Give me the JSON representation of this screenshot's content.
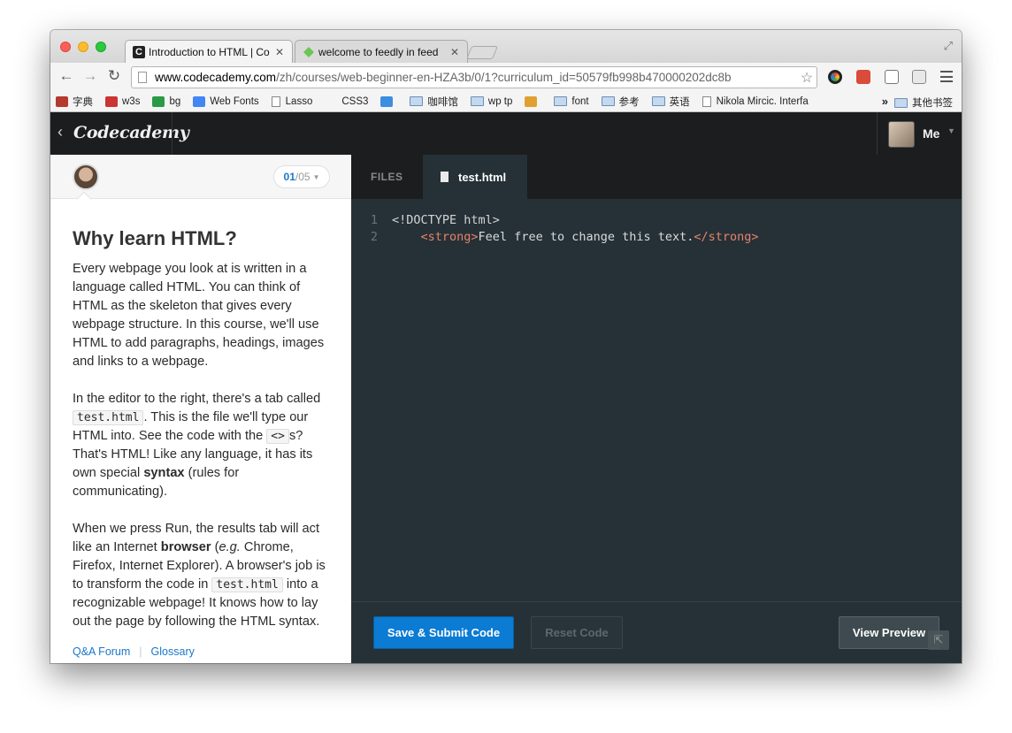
{
  "browser": {
    "tabs": [
      {
        "title": "Introduction to HTML | Co",
        "favicon": "C"
      },
      {
        "title": "welcome to feedly in feed",
        "favicon": ""
      }
    ],
    "url_domain": "www.codecademy.com",
    "url_path": "/zh/courses/web-beginner-en-HZA3b/0/1?curriculum_id=50579fb998b470000202dc8b",
    "bookmarks": [
      {
        "label": "字典",
        "kind": "site",
        "color": "#b33a2d"
      },
      {
        "label": "w3s",
        "kind": "site",
        "color": "#cc3333"
      },
      {
        "label": "bg",
        "kind": "site",
        "color": "#2a9a47"
      },
      {
        "label": "Web Fonts",
        "kind": "site",
        "color": "#4285f4"
      },
      {
        "label": "Lasso",
        "kind": "doc"
      },
      {
        "label": "CSS3",
        "kind": "site",
        "color": "#f4f4f4"
      },
      {
        "label": "",
        "kind": "site",
        "color": "#3d8ee0"
      },
      {
        "label": "咖啡馆",
        "kind": "folder"
      },
      {
        "label": "wp tp",
        "kind": "folder"
      },
      {
        "label": "",
        "kind": "site",
        "color": "#e0a030"
      },
      {
        "label": "font",
        "kind": "folder"
      },
      {
        "label": "参考",
        "kind": "folder"
      },
      {
        "label": "英语",
        "kind": "folder"
      },
      {
        "label": "Nikola Mircic. Interfa",
        "kind": "doc"
      }
    ],
    "bookmarks_more": "»",
    "other_bookmarks": "其他书签"
  },
  "site": {
    "logo": "Codecademy",
    "user_label": "Me"
  },
  "lesson": {
    "progress_current": "01",
    "progress_total": "/05",
    "title": "Why learn HTML?",
    "p1": "Every webpage you look at is written in a language called HTML. You can think of HTML as the skeleton that gives every webpage structure. In this course, we'll use HTML to add paragraphs, headings, images and links to a webpage.",
    "p2_a": "In the editor to the right, there's a tab called ",
    "p2_code1": "test.html",
    "p2_b": ". This is the file we'll type our HTML into. See the code with the ",
    "p2_code2": "<>",
    "p2_c": "s? That's HTML! Like any language, it has its own special ",
    "p2_bold": "syntax",
    "p2_d": " (rules for communicating).",
    "p3_a": "When we press Run, the results tab will act like an Internet ",
    "p3_bold": "browser",
    "p3_b": " (",
    "p3_italic": "e.g.",
    "p3_c": " Chrome, Firefox, Internet Explorer). A browser's job is to transform the code in ",
    "p3_code": "test.html",
    "p3_d": " into a recognizable webpage! It knows how to lay out the page by following the HTML syntax.",
    "footer_forum": "Q&A Forum",
    "footer_glossary": "Glossary"
  },
  "editor": {
    "files_label": "FILES",
    "file_tab": "test.html",
    "lines": [
      {
        "num": "1",
        "plain": "<!DOCTYPE html>"
      },
      {
        "num": "2",
        "indent": "    ",
        "open": "<strong>",
        "text": "Feel free to change this text.",
        "close": "</strong>"
      }
    ],
    "submit_label": "Save & Submit Code",
    "reset_label": "Reset Code",
    "preview_label": "View Preview"
  },
  "colors": {
    "accent_blue": "#0b7bd3",
    "header_dark": "#1b1d1e",
    "editor_bg": "#253136",
    "tag_color": "#e8816c"
  }
}
